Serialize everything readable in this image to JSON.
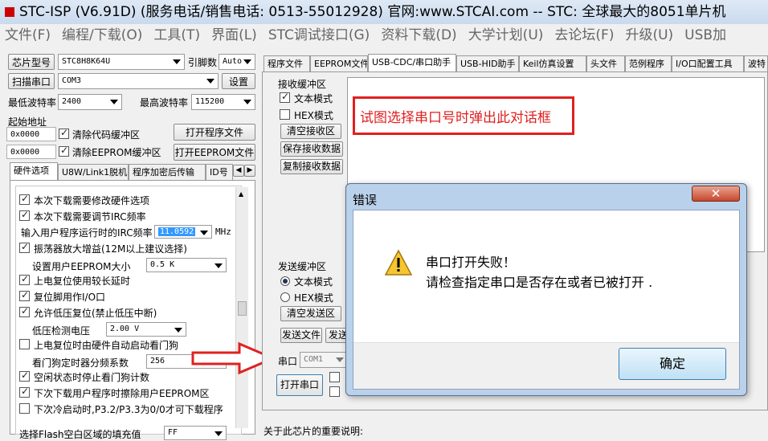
{
  "window": {
    "title": "STC-ISP (V6.91D) (服务电话/销售电话: 0513-55012928) 官网:www.STCAI.com  -- STC: 全球最大的8051单片机"
  },
  "menu": [
    "文件(F)",
    "编程/下载(O)",
    "工具(T)",
    "界面(L)",
    "STC调试接口(G)",
    "资料下载(D)",
    "大学计划(U)",
    "去论坛(F)",
    "升级(U)",
    "USB加"
  ],
  "left": {
    "chip_label": "芯片型号",
    "chip_value": "STC8H8K64U",
    "pin_label": "引脚数",
    "pin_value": "Auto",
    "scan_button": "扫描串口",
    "port_value": "COM3",
    "settings_button": "设置",
    "min_baud_label": "最低波特率",
    "min_baud_value": "2400",
    "max_baud_label": "最高波特率",
    "max_baud_value": "115200",
    "start_addr_label": "起始地址",
    "addr1": "0x0000",
    "clear_code_label": "清除代码缓冲区",
    "open_prog_button": "打开程序文件",
    "addr2": "0x0000",
    "clear_eeprom_label": "清除EEPROM缓冲区",
    "open_eeprom_button": "打开EEPROM文件",
    "tabs": [
      "硬件选项",
      "U8W/Link1脱机",
      "程序加密后传输",
      "ID号"
    ],
    "options": [
      {
        "text": "本次下载需要修改硬件选项",
        "checked": true
      },
      {
        "text": "本次下载需要调节IRC频率",
        "checked": true
      },
      {
        "text": "振荡器放大增益(12M以上建议选择)",
        "checked": true
      },
      {
        "text": "上电复位使用较长延时",
        "checked": true
      },
      {
        "text": "复位脚用作I/O口",
        "checked": true
      },
      {
        "text": "允许低压复位(禁止低压中断)",
        "checked": true
      },
      {
        "text": "上电复位时由硬件自动启动看门狗",
        "checked": false
      },
      {
        "text": "空闲状态时停止看门狗计数",
        "checked": true
      },
      {
        "text": "下次下载用户程序时擦除用户EEPROM区",
        "checked": true
      },
      {
        "text": "下次冷启动时,P3.2/P3.3为0/0才可下载程序",
        "checked": false
      }
    ],
    "irc_label": "输入用户程序运行时的IRC频率",
    "irc_value": "11.0592",
    "irc_unit": "MHz",
    "eeprom_size_label": "设置用户EEPROM大小",
    "eeprom_size_value": "0.5 K",
    "low_voltage_label": "低压检测电压",
    "low_voltage_value": "2.00 V",
    "wdt_label": "看门狗定时器分频系数",
    "wdt_value": "256",
    "flash_fill_label": "选择Flash空白区域的填充值",
    "flash_fill_value": "FF"
  },
  "right": {
    "tabs": [
      "程序文件",
      "EEPROM文件",
      "USB-CDC/串口助手",
      "USB-HID助手",
      "Keil仿真设置",
      "头文件",
      "范例程序",
      "I/O口配置工具",
      "波特"
    ],
    "recv_label": "接收缓冲区",
    "text_mode": "文本模式",
    "hex_mode": "HEX模式",
    "clear_recv": "清空接收区",
    "save_recv": "保存接收数据",
    "copy_recv": "复制接收数据",
    "annotation": "试图选择串口号时弹出此对话框",
    "send_label": "发送缓冲区",
    "clear_send": "清空发送区",
    "send_file": "发送文件",
    "send_partial": "发送",
    "port_label": "串口",
    "port_value": "COM1",
    "open_port": "打开串口",
    "bottom_note": "关于此芯片的重要说明:"
  },
  "dialog": {
    "title": "错误",
    "close": "✕",
    "line1": "串口打开失败！",
    "line2": "请检查指定串口是否存在或者已被打开 .",
    "ok": "确定"
  },
  "colors": {
    "annotation_red": "#e02020",
    "selection_blue": "#3399ff"
  }
}
